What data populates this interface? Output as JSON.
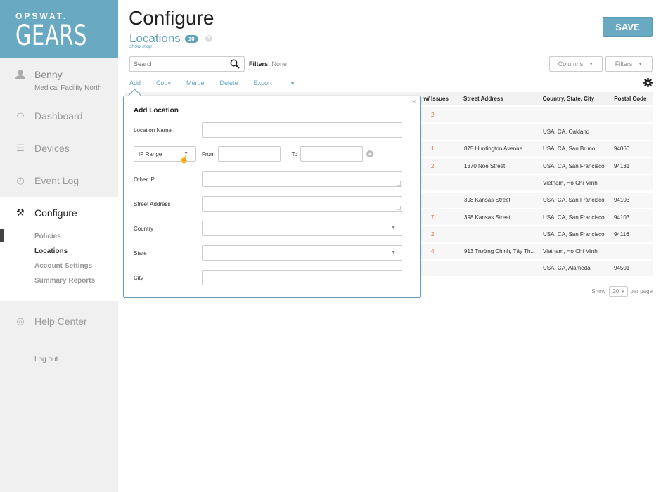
{
  "logo": {
    "small": "OPSWAT.",
    "big": "GEARS"
  },
  "user": {
    "name": "Benny",
    "org": "Medical Facility North",
    "icon": "user-icon"
  },
  "nav": [
    {
      "label": "Dashboard",
      "icon": "dashboard-gauge-icon"
    },
    {
      "label": "Devices",
      "icon": "list-icon"
    },
    {
      "label": "Event Log",
      "icon": "clock-icon"
    },
    {
      "label": "Configure",
      "icon": "tools-icon",
      "active": true
    },
    {
      "label": "Help Center",
      "icon": "lifebuoy-icon"
    }
  ],
  "subnav": [
    {
      "label": "Policies"
    },
    {
      "label": "Locations",
      "current": true
    },
    {
      "label": "Account Settings"
    },
    {
      "label": "Summary Reports"
    }
  ],
  "logout": "Log out",
  "header": {
    "title": "Configure",
    "subtitle": "Locations",
    "count_badge": "10",
    "help": "?",
    "show_map": "show map",
    "save_label": "SAVE"
  },
  "search": {
    "placeholder": "Search",
    "value": ""
  },
  "filters": {
    "label": "Filters:",
    "value": "None"
  },
  "toolbar": {
    "add": "Add",
    "copy": "Copy",
    "merge": "Merge",
    "delete": "Delete",
    "export": "Export"
  },
  "buttons": {
    "columns": "Columns",
    "filters": "Filters"
  },
  "table": {
    "headers": [
      "",
      "w/ Issues",
      "Street Address",
      "Country, State, City",
      "Postal Code"
    ],
    "rows": [
      {
        "issues": "2",
        "street": "",
        "region": "",
        "postal": ""
      },
      {
        "issues": "",
        "street": "",
        "region": "USA, CA, Oakland",
        "postal": ""
      },
      {
        "issues": "1",
        "street": "875 Huntington Avenue",
        "region": "USA, CA, San Bruno",
        "postal": "94066"
      },
      {
        "issues": "2",
        "street": "1370 Noe Street",
        "region": "USA, CA, San Francisco",
        "postal": "94131"
      },
      {
        "issues": "",
        "street": "",
        "region": "Vietnam, Ho Chi Minh",
        "postal": ""
      },
      {
        "issues": "",
        "street": "398 Kansas Street",
        "region": "USA, CA, San Francisco",
        "postal": "94103"
      },
      {
        "issues": "7",
        "street": "398 Kansas Street",
        "region": "USA, CA, San Francisco",
        "postal": "94103"
      },
      {
        "issues": "2",
        "street": "",
        "region": "USA, CA, San Francisco",
        "postal": "94116"
      },
      {
        "issues": "4",
        "street": "913 Trường Chinh, Tây Th...",
        "region": "Vietnam, Ho Chi Minh",
        "postal": ""
      },
      {
        "issues": "",
        "street": "",
        "region": "USA, CA, Alameda",
        "postal": "94501"
      }
    ]
  },
  "pager": {
    "show": "Show",
    "value": "20",
    "per_page": "per page"
  },
  "popup": {
    "title": "Add Location",
    "close": "×",
    "location_name": {
      "label": "Location Name",
      "value": ""
    },
    "ip_type": {
      "value": "IP Range"
    },
    "from": {
      "label": "From",
      "value": ""
    },
    "to": {
      "label": "To",
      "value": ""
    },
    "add_range": "+",
    "other_ip": {
      "label": "Other IP",
      "value": ""
    },
    "street": {
      "label": "Street Address",
      "value": ""
    },
    "country": {
      "label": "Country",
      "value": ""
    },
    "state": {
      "label": "State",
      "value": ""
    },
    "city": {
      "label": "City",
      "value": ""
    }
  },
  "colors": {
    "brand": "#69a9c2",
    "accent": "#5fa2bd",
    "issue": "#e26a46"
  }
}
